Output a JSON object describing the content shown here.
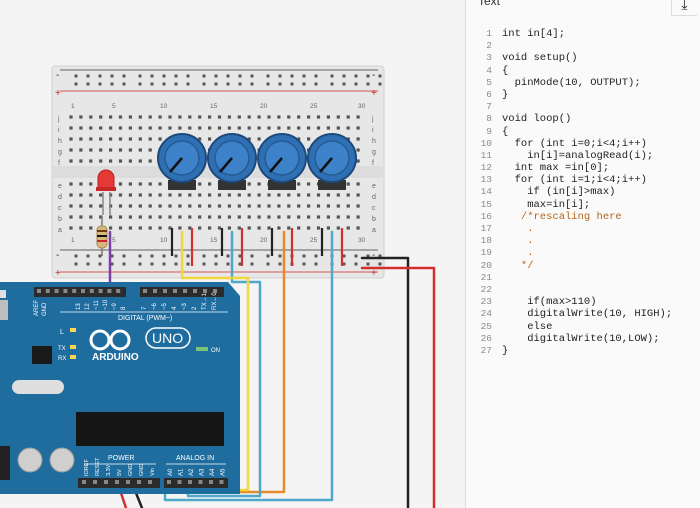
{
  "code_panel": {
    "header_label": "Text",
    "download_icon": "download-icon",
    "lines": [
      {
        "n": "1",
        "text": "int in[4];"
      },
      {
        "n": "2",
        "text": ""
      },
      {
        "n": "3",
        "text": "void setup()"
      },
      {
        "n": "4",
        "text": "{"
      },
      {
        "n": "5",
        "text": "  pinMode(10, OUTPUT);"
      },
      {
        "n": "6",
        "text": "}"
      },
      {
        "n": "7",
        "text": ""
      },
      {
        "n": "8",
        "text": "void loop()"
      },
      {
        "n": "9",
        "text": "{"
      },
      {
        "n": "10",
        "text": "  for (int i=0;i<4;i++)"
      },
      {
        "n": "11",
        "text": "    in[i]=analogRead(i);"
      },
      {
        "n": "12",
        "text": "  int max =in[0];"
      },
      {
        "n": "13",
        "text": "  for (int i=1;i<4;i++)"
      },
      {
        "n": "14",
        "text": "    if (in[i]>max)"
      },
      {
        "n": "15",
        "text": "    max=in[i];"
      },
      {
        "n": "16",
        "text": "   /*rescaling here"
      },
      {
        "n": "17",
        "text": "    ."
      },
      {
        "n": "18",
        "text": "    ."
      },
      {
        "n": "19",
        "text": "    ."
      },
      {
        "n": "20",
        "text": "   */"
      },
      {
        "n": "21",
        "text": ""
      },
      {
        "n": "22",
        "text": ""
      },
      {
        "n": "23",
        "text": "    if(max>110)"
      },
      {
        "n": "24",
        "text": "    digitalWrite(10, HIGH);"
      },
      {
        "n": "25",
        "text": "    else"
      },
      {
        "n": "26",
        "text": "    digitalWrite(10,LOW);"
      },
      {
        "n": "27",
        "text": "}"
      }
    ]
  },
  "arduino": {
    "board_name": "UNO",
    "brand": "ARDUINO",
    "digital_label": "DIGITAL (PWM~)",
    "power_label": "POWER",
    "analog_label": "ANALOG IN",
    "on_label": "ON",
    "l_label": "L",
    "tx_label": "TX",
    "rx_label": "RX",
    "aref_label": "AREF",
    "gnd_label": "GND",
    "digital_pins": [
      "13",
      "12",
      "~11",
      "~10",
      "~9",
      "8",
      "7",
      "~6",
      "~5",
      "4",
      "~3",
      "2",
      "TX→1",
      "RX←0"
    ],
    "power_pins": [
      "IOREF",
      "RESET",
      "3.3V",
      "5V",
      "GND",
      "GND",
      "Vin"
    ],
    "analog_pins": [
      "A0",
      "A1",
      "A2",
      "A3",
      "A4",
      "A5"
    ]
  },
  "breadboard": {
    "columns": [
      "1",
      "5",
      "10",
      "15",
      "20",
      "25",
      "30"
    ],
    "rows_top": [
      "j",
      "i",
      "h",
      "g",
      "f"
    ],
    "rows_bottom": [
      "e",
      "d",
      "c",
      "b",
      "a"
    ],
    "rail_plus": "+",
    "rail_minus": "-"
  },
  "components": {
    "potentiometers": 4,
    "led_color": "#e53935",
    "pot_color": "#2f6fb3"
  },
  "colors": {
    "wire_black": "#222222",
    "wire_red": "#d32f2f",
    "wire_yellow": "#f2d640",
    "wire_orange": "#e8892b",
    "wire_blue": "#4fa8c9",
    "wire_purple": "#7b3fa6",
    "board": "#1f6c9e",
    "breadboard": "#e7e7e7"
  }
}
